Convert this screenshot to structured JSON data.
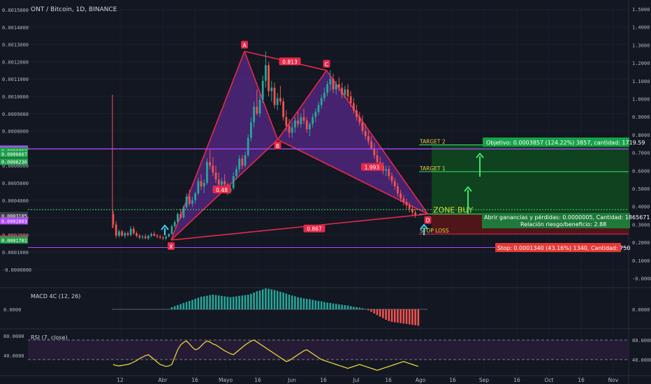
{
  "chart_data": {
    "type": "candlestick",
    "title": "ONT / Bitcoin, 1D, BINANCE",
    "colors": {
      "background": "#131722",
      "up": "#26a69a",
      "down": "#ef5350",
      "pattern_line": "#e5294a",
      "pattern_fill": "#5b2a8e",
      "target_zone": "#0f4a1f",
      "stop_zone": "#5a1518",
      "macd_up": "#26a69a",
      "macd_down": "#ef5350",
      "rsi_line": "#f5e13c",
      "rsi_band": "#2a1d3a",
      "purple_line": "#b048ff",
      "green_arrow": "#39e66a",
      "cyan_arrow": "#4ad5f5"
    },
    "x_axis": {
      "ticks": [
        "12",
        "Abr",
        "16",
        "Mayo",
        "16",
        "Jun",
        "16",
        "Jul",
        "16",
        "Ago",
        "16",
        "Sep",
        "16",
        "Oct",
        "16",
        "Nov"
      ]
    },
    "y_axis_left": {
      "ticks": [
        "0.0015000",
        "0.0014000",
        "0.0013000",
        "0.0012000",
        "0.0011000",
        "0.0010000",
        "0.0009000",
        "0.0008000",
        "0.0007000",
        "0.0006000",
        "0.0005000",
        "0.0004000",
        "0.0003000",
        "0.0002000",
        "0.0001000",
        "-0.0000000"
      ],
      "range": [
        -1e-05,
        0.0015
      ]
    },
    "y_axis_right": {
      "ticks": [
        "1.5000",
        "1.4000",
        "1.3000",
        "1.2000",
        "1.1000",
        "1.0000",
        "0.9000",
        "0.8000",
        "0.7000",
        "0.6000",
        "0.5000",
        "0.4000",
        "0.3000",
        "0.2000",
        "0.1000",
        "-0.0000"
      ]
    },
    "price_labels": [
      {
        "text": "0.0006961",
        "value": 0.0006961,
        "color": "#b048ff"
      },
      {
        "text": "0.0006862",
        "value": 0.0006862,
        "color": "#1fa04a"
      },
      {
        "text": "0.0006667",
        "value": 0.0006667,
        "color": "#1fa04a"
      },
      {
        "text": "0.0006236",
        "value": 0.0006236,
        "color": "#1fa04a"
      },
      {
        "text": "0.0003110",
        "value": 0.000311,
        "color": "#1fa04a"
      },
      {
        "text": "0.0003105",
        "value": 0.0003105,
        "color": "#3b3f4a"
      },
      {
        "text": "0.0002803",
        "value": 0.0002803,
        "color": "#b048ff"
      },
      {
        "text": "0.0001765",
        "value": 0.0001765,
        "color": "#e5294a"
      },
      {
        "text": "0.0001701",
        "value": 0.0001701,
        "color": "#1fa04a"
      }
    ],
    "pattern_points": [
      {
        "label": "X",
        "day": 34,
        "price": 0.00017
      },
      {
        "label": "A",
        "day": 76,
        "price": 0.00126
      },
      {
        "label": "B",
        "day": 95,
        "price": 0.00075
      },
      {
        "label": "C",
        "day": 123,
        "price": 0.00115
      },
      {
        "label": "D",
        "day": 181,
        "price": 0.00032
      }
    ],
    "ratios": [
      {
        "text": "0.813",
        "day": 102,
        "price": 0.0012
      },
      {
        "text": "0.48",
        "day": 63,
        "price": 0.00046
      },
      {
        "text": "1.993",
        "day": 149,
        "price": 0.00059
      },
      {
        "text": "0.867",
        "day": 116,
        "price": 0.000235
      }
    ],
    "levels": [
      {
        "text": "TARGET 2",
        "price": 0.00072
      },
      {
        "text": "TARGET 1",
        "price": 0.000565
      },
      {
        "text": "ZONE BUY",
        "price": 0.00032
      },
      {
        "text": "STOP LOSS",
        "price": 0.000205
      }
    ],
    "purple_level": 0.0006961,
    "purple_level_low": 0.0002803,
    "green_dotted_level": 0.000346,
    "boxes": {
      "objective": "Objetivo: 0.0003857 (124.22%) 3857, cantidad: 1719.59",
      "pnl": "Abrir ganancias y pérdidas: 0.0000005, Cantidad: 1865671",
      "ratio": "Relación riesgo/beneficio: 2.88",
      "stop": "Stop: 0.0001340 (43.16%) 1340, Cantidad: 750"
    },
    "candles_ohlc": [
      [
        0.00032,
        0.00034,
        0.00024,
        0.00026
      ],
      [
        0.00026,
        0.00028,
        0.00018,
        0.000195
      ],
      [
        0.000195,
        0.00023,
        0.000185,
        0.00022
      ],
      [
        0.00022,
        0.00023,
        0.00019,
        0.000195
      ],
      [
        0.000195,
        0.00022,
        0.00018,
        0.00021
      ],
      [
        0.00021,
        0.00022,
        0.00019,
        0.0002
      ],
      [
        0.0002,
        0.00025,
        0.00019,
        0.000235
      ],
      [
        0.000235,
        0.00025,
        0.0002,
        0.00021
      ],
      [
        0.00021,
        0.00022,
        0.000185,
        0.000195
      ],
      [
        0.000195,
        0.000205,
        0.000175,
        0.000185
      ],
      [
        0.000185,
        0.0002,
        0.000175,
        0.00019
      ],
      [
        0.00019,
        0.000205,
        0.000175,
        0.00018
      ],
      [
        0.00018,
        0.0002,
        0.00017,
        0.000195
      ],
      [
        0.000195,
        0.000215,
        0.000185,
        0.000205
      ],
      [
        0.000205,
        0.00022,
        0.00019,
        0.000195
      ],
      [
        0.000195,
        0.000205,
        0.00018,
        0.00019
      ],
      [
        0.00019,
        0.0002,
        0.000175,
        0.000185
      ],
      [
        0.000185,
        0.000195,
        0.00017,
        0.00018
      ],
      [
        0.00018,
        0.000195,
        0.00017,
        0.00019
      ],
      [
        0.00019,
        0.00021,
        0.000185,
        0.000205
      ],
      [
        0.000205,
        0.00026,
        0.0002,
        0.00025
      ],
      [
        0.00025,
        0.000285,
        0.00024,
        0.000275
      ],
      [
        0.000275,
        0.00033,
        0.00027,
        0.00032
      ],
      [
        0.00032,
        0.00035,
        0.00029,
        0.0003
      ],
      [
        0.0003,
        0.00037,
        0.000295,
        0.00036
      ],
      [
        0.00036,
        0.00044,
        0.00035,
        0.00042
      ],
      [
        0.00042,
        0.00046,
        0.00037,
        0.00038
      ],
      [
        0.00038,
        0.00042,
        0.00036,
        0.0004
      ],
      [
        0.0004,
        0.00045,
        0.00038,
        0.00044
      ],
      [
        0.00044,
        0.00053,
        0.00043,
        0.00051
      ],
      [
        0.00051,
        0.00055,
        0.00046,
        0.00048
      ],
      [
        0.00048,
        0.00052,
        0.00044,
        0.0005
      ],
      [
        0.0005,
        0.00064,
        0.00049,
        0.00062
      ],
      [
        0.00062,
        0.00069,
        0.00058,
        0.0006
      ],
      [
        0.0006,
        0.00065,
        0.00054,
        0.00056
      ],
      [
        0.00056,
        0.0006,
        0.0005,
        0.00052
      ],
      [
        0.00052,
        0.00056,
        0.00047,
        0.00049
      ],
      [
        0.00049,
        0.00053,
        0.00045,
        0.00051
      ],
      [
        0.00051,
        0.00055,
        0.00048,
        0.00049
      ],
      [
        0.00049,
        0.0005,
        0.00043,
        0.00045
      ],
      [
        0.00045,
        0.00049,
        0.00044,
        0.00047
      ],
      [
        0.00047,
        0.00056,
        0.00046,
        0.00054
      ],
      [
        0.00054,
        0.0006,
        0.00052,
        0.00058
      ],
      [
        0.00058,
        0.00066,
        0.00056,
        0.00064
      ],
      [
        0.00064,
        0.00066,
        0.00058,
        0.0006
      ],
      [
        0.0006,
        0.00068,
        0.00059,
        0.00066
      ],
      [
        0.00066,
        0.00078,
        0.00065,
        0.00076
      ],
      [
        0.00076,
        0.00088,
        0.00074,
        0.00085
      ],
      [
        0.00085,
        0.00097,
        0.00082,
        0.00094
      ],
      [
        0.00094,
        0.00104,
        0.00089,
        0.0009
      ],
      [
        0.0009,
        0.00101,
        0.00088,
        0.00098
      ],
      [
        0.00098,
        0.00112,
        0.00096,
        0.00109
      ],
      [
        0.00109,
        0.00126,
        0.00105,
        0.00118
      ],
      [
        0.00118,
        0.0012,
        0.001,
        0.00103
      ],
      [
        0.00103,
        0.00109,
        0.00097,
        0.00105
      ],
      [
        0.00105,
        0.00108,
        0.00093,
        0.00095
      ],
      [
        0.00095,
        0.00102,
        0.00092,
        0.00099
      ],
      [
        0.00099,
        0.00106,
        0.00095,
        0.00097
      ],
      [
        0.00097,
        0.00099,
        0.00086,
        0.00088
      ],
      [
        0.00088,
        0.00092,
        0.0008,
        0.00083
      ],
      [
        0.00083,
        0.00087,
        0.00076,
        0.00079
      ],
      [
        0.00079,
        0.00085,
        0.00076,
        0.00082
      ],
      [
        0.00082,
        0.00088,
        0.00079,
        0.00086
      ],
      [
        0.00086,
        0.00091,
        0.00082,
        0.00084
      ],
      [
        0.00084,
        0.0009,
        0.00082,
        0.00088
      ],
      [
        0.00088,
        0.00093,
        0.00084,
        0.00086
      ],
      [
        0.00086,
        0.00088,
        0.00079,
        0.00081
      ],
      [
        0.00081,
        0.00085,
        0.00077,
        0.00084
      ],
      [
        0.00084,
        0.0009,
        0.00082,
        0.00088
      ],
      [
        0.00088,
        0.00093,
        0.00085,
        0.00091
      ],
      [
        0.00091,
        0.00097,
        0.00089,
        0.00095
      ],
      [
        0.00095,
        0.00101,
        0.00093,
        0.00099
      ],
      [
        0.00099,
        0.00105,
        0.00097,
        0.00102
      ],
      [
        0.00102,
        0.00109,
        0.001,
        0.00107
      ],
      [
        0.00107,
        0.00115,
        0.00103,
        0.0011
      ],
      [
        0.0011,
        0.00113,
        0.00102,
        0.00104
      ],
      [
        0.00104,
        0.00109,
        0.00101,
        0.00107
      ],
      [
        0.00107,
        0.00111,
        0.00103,
        0.00105
      ],
      [
        0.00105,
        0.00108,
        0.00099,
        0.00101
      ],
      [
        0.00101,
        0.00106,
        0.00099,
        0.00104
      ],
      [
        0.00104,
        0.00107,
        0.00098,
        0.001
      ],
      [
        0.001,
        0.00103,
        0.00094,
        0.00096
      ],
      [
        0.00096,
        0.00099,
        0.0009,
        0.00092
      ],
      [
        0.00092,
        0.00095,
        0.00086,
        0.00088
      ],
      [
        0.00088,
        0.00091,
        0.00083,
        0.00085
      ],
      [
        0.00085,
        0.00089,
        0.00078,
        0.0008
      ],
      [
        0.0008,
        0.00084,
        0.00075,
        0.00077
      ],
      [
        0.00077,
        0.0008,
        0.00072,
        0.00074
      ],
      [
        0.00074,
        0.00077,
        0.00069,
        0.0007
      ],
      [
        0.0007,
        0.00073,
        0.00064,
        0.00066
      ],
      [
        0.00066,
        0.00069,
        0.0006,
        0.00062
      ],
      [
        0.00062,
        0.00065,
        0.00058,
        0.0006
      ],
      [
        0.0006,
        0.00062,
        0.00055,
        0.00057
      ],
      [
        0.00057,
        0.0006,
        0.00054,
        0.00058
      ],
      [
        0.00058,
        0.0006,
        0.00052,
        0.00054
      ],
      [
        0.00054,
        0.00056,
        0.00049,
        0.00051
      ],
      [
        0.00051,
        0.00053,
        0.00046,
        0.00048
      ],
      [
        0.00048,
        0.0005,
        0.00042,
        0.00044
      ],
      [
        0.00044,
        0.00046,
        0.00039,
        0.00041
      ],
      [
        0.00041,
        0.00043,
        0.00037,
        0.00039
      ],
      [
        0.00039,
        0.00041,
        0.00035,
        0.00037
      ],
      [
        0.00037,
        0.00039,
        0.00033,
        0.00035
      ],
      [
        0.00035,
        0.00037,
        0.00031,
        0.00033
      ],
      [
        0.00033,
        0.00035,
        0.0003,
        0.000315
      ]
    ],
    "macd": [
      0,
      0,
      0,
      0,
      0,
      0,
      0,
      0,
      0,
      0,
      0,
      0,
      0,
      0,
      0,
      0,
      0,
      0,
      0,
      0,
      0.1,
      0.15,
      0.2,
      0.25,
      0.3,
      0.35,
      0.4,
      0.45,
      0.5,
      0.55,
      0.6,
      0.62,
      0.65,
      0.68,
      0.7,
      0.68,
      0.66,
      0.64,
      0.62,
      0.6,
      0.58,
      0.6,
      0.62,
      0.64,
      0.66,
      0.68,
      0.7,
      0.74,
      0.8,
      0.86,
      0.9,
      0.95,
      1.0,
      0.98,
      0.95,
      0.92,
      0.88,
      0.84,
      0.8,
      0.75,
      0.7,
      0.66,
      0.62,
      0.58,
      0.55,
      0.52,
      0.5,
      0.48,
      0.45,
      0.42,
      0.4,
      0.38,
      0.35,
      0.32,
      0.3,
      0.28,
      0.26,
      0.24,
      0.22,
      0.2,
      0.18,
      0.15,
      0.12,
      0.1,
      0.08,
      0.05,
      0.02,
      -0.05,
      -0.12,
      -0.2,
      -0.28,
      -0.35,
      -0.42,
      -0.5,
      -0.56,
      -0.6,
      -0.62,
      -0.64,
      -0.66,
      -0.68,
      -0.7,
      -0.72,
      -0.74,
      -0.76,
      -0.78
    ],
    "rsi": [
      30,
      28,
      27,
      28,
      29,
      30,
      32,
      35,
      38,
      42,
      45,
      48,
      50,
      45,
      40,
      35,
      30,
      28,
      26,
      27,
      30,
      45,
      60,
      70,
      75,
      78,
      72,
      65,
      60,
      62,
      68,
      74,
      78,
      76,
      72,
      70,
      66,
      62,
      58,
      55,
      52,
      50,
      55,
      60,
      65,
      70,
      74,
      78,
      80,
      76,
      72,
      68,
      64,
      60,
      56,
      52,
      48,
      44,
      40,
      36,
      38,
      42,
      46,
      50,
      54,
      58,
      60,
      56,
      52,
      48,
      44,
      40,
      38,
      36,
      34,
      32,
      30,
      28,
      26,
      24,
      22,
      24,
      26,
      28,
      30,
      28,
      26,
      24,
      22,
      20,
      18,
      20,
      22,
      24,
      26,
      28,
      30,
      32,
      34,
      36,
      34,
      32,
      30,
      28,
      26
    ],
    "macd_label": "MACD 4C (12, 26)",
    "macd_zero": "0.0000",
    "rsi_label": "RSI (7, close)",
    "rsi_ticks": [
      "80.0000",
      "40.0000"
    ]
  }
}
